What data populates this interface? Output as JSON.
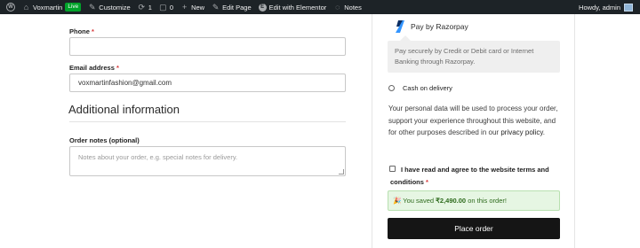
{
  "adminbar": {
    "site_name": "Voxmartin",
    "live_badge": "Live",
    "customize": "Customize",
    "updates_count": "1",
    "comments_count": "0",
    "new_label": "New",
    "edit_page": "Edit Page",
    "edit_elementor": "Edit with Elementor",
    "notes": "Notes",
    "howdy": "Howdy, admin"
  },
  "form": {
    "phone_label": "Phone",
    "phone_value": "",
    "email_label": "Email address",
    "email_value": "voxmartinfashion@gmail.com",
    "required_marker": "*",
    "additional_title": "Additional information",
    "order_notes_label": "Order notes (optional)",
    "order_notes_placeholder": "Notes about your order, e.g. special notes for delivery."
  },
  "payment": {
    "razorpay_label": "Pay by Razorpay",
    "razorpay_desc": "Pay securely by Credit or Debit card or Internet Banking through Razorpay.",
    "cod_label": "Cash on delivery",
    "privacy_text": "Your personal data will be used to process your order, support your experience throughout this website, and for other purposes described in our",
    "privacy_link": "privacy policy",
    "privacy_end": ".",
    "terms_label": "I have read and agree to the website terms and conditions",
    "terms_required": "*",
    "saved_prefix": "🎉 You saved",
    "saved_amount": "₹2,490.00",
    "saved_suffix": "on this order!",
    "place_order": "Place order"
  },
  "colors": {
    "adminbar_bg": "#1d2327",
    "live_green": "#00a32a",
    "required_red": "#d63638",
    "saved_bg": "#e6f6e3",
    "button_bg": "#151515",
    "razorpay_blue": "#3395ff"
  }
}
